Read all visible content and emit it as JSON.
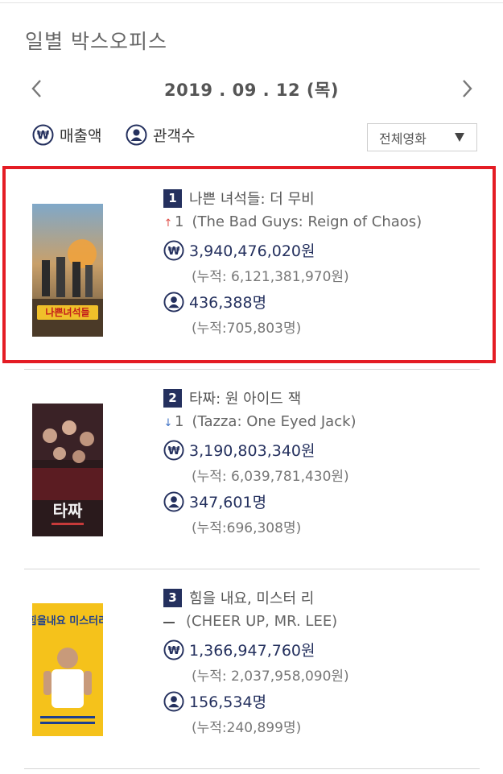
{
  "page": {
    "title": "일별 박스오피스"
  },
  "date_nav": {
    "date": "2019 . 09 . 12 (목)"
  },
  "toggles": {
    "revenue_label": "매출액",
    "audience_label": "관객수"
  },
  "filter": {
    "selected": "전체영화"
  },
  "colors": {
    "accent": "#24305e",
    "highlight": "#e41c24",
    "up": "#e0504a",
    "down": "#3b6fc4"
  },
  "movies": [
    {
      "rank": "1",
      "title": "나쁜 녀석들: 더 무비",
      "rank_change": "1",
      "rank_change_dir": "up",
      "en_title": "(The Bad Guys: Reign of Chaos)",
      "sales": "3,940,476,020원",
      "sales_cum": "(누적: 6,121,381,970원)",
      "audience": "436,388명",
      "audience_cum": "(누적:705,803명)",
      "poster_text": "나쁜녀석들"
    },
    {
      "rank": "2",
      "title": "타짜: 원 아이드 잭",
      "rank_change": "1",
      "rank_change_dir": "down",
      "en_title": "(Tazza: One Eyed Jack)",
      "sales": "3,190,803,340원",
      "sales_cum": "(누적: 6,039,781,430원)",
      "audience": "347,601명",
      "audience_cum": "(누적:696,308명)",
      "poster_text": "타짜"
    },
    {
      "rank": "3",
      "title": "힘을 내요, 미스터 리",
      "rank_change": "",
      "rank_change_dir": "none",
      "en_title": "(CHEER UP, MR. LEE)",
      "sales": "1,366,947,760원",
      "sales_cum": "(누적: 2,037,958,090원)",
      "audience": "156,534명",
      "audience_cum": "(누적:240,899명)",
      "poster_text": "힘을내요 미스터리"
    }
  ]
}
